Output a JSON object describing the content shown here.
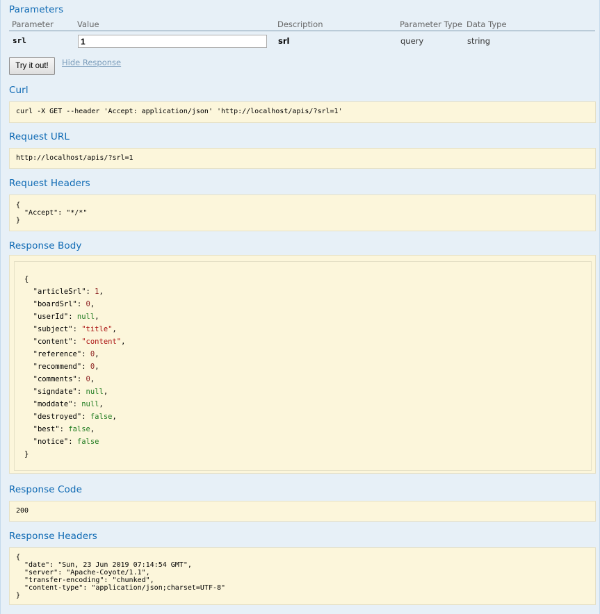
{
  "parameters": {
    "title": "Parameters",
    "headers": [
      "Parameter",
      "Value",
      "Description",
      "Parameter Type",
      "Data Type"
    ],
    "rows": [
      {
        "name": "srl",
        "value": "1",
        "description": "srl",
        "param_type": "query",
        "data_type": "string"
      }
    ]
  },
  "actions": {
    "try_label": "Try it out!",
    "hide_label": "Hide Response"
  },
  "curl": {
    "title": "Curl",
    "command": "curl -X GET --header 'Accept: application/json' 'http://localhost/apis/?srl=1'"
  },
  "request_url": {
    "title": "Request URL",
    "url": "http://localhost/apis/?srl=1"
  },
  "request_headers": {
    "title": "Request Headers",
    "lines": [
      "{",
      "  \"Accept\": \"*/*\"",
      "}"
    ]
  },
  "response_body": {
    "title": "Response Body",
    "open": "{",
    "close": "}",
    "fields": [
      {
        "key": "\"articleSrl\"",
        "value": "1",
        "type": "n",
        "comma": true
      },
      {
        "key": "\"boardSrl\"",
        "value": "0",
        "type": "n",
        "comma": true
      },
      {
        "key": "\"userId\"",
        "value": "null",
        "type": "l",
        "comma": true
      },
      {
        "key": "\"subject\"",
        "value": "\"title\"",
        "type": "s",
        "comma": true
      },
      {
        "key": "\"content\"",
        "value": "\"content\"",
        "type": "s",
        "comma": true
      },
      {
        "key": "\"reference\"",
        "value": "0",
        "type": "n",
        "comma": true
      },
      {
        "key": "\"recommend\"",
        "value": "0",
        "type": "n",
        "comma": true
      },
      {
        "key": "\"comments\"",
        "value": "0",
        "type": "n",
        "comma": true
      },
      {
        "key": "\"signdate\"",
        "value": "null",
        "type": "l",
        "comma": true
      },
      {
        "key": "\"moddate\"",
        "value": "null",
        "type": "l",
        "comma": true
      },
      {
        "key": "\"destroyed\"",
        "value": "false",
        "type": "l",
        "comma": true
      },
      {
        "key": "\"best\"",
        "value": "false",
        "type": "l",
        "comma": true
      },
      {
        "key": "\"notice\"",
        "value": "false",
        "type": "l",
        "comma": false
      }
    ]
  },
  "response_code": {
    "title": "Response Code",
    "code": "200"
  },
  "response_headers": {
    "title": "Response Headers",
    "lines": [
      "{",
      "  \"date\": \"Sun, 23 Jun 2019 07:14:54 GMT\",",
      "  \"server\": \"Apache-Coyote/1.1\",",
      "  \"transfer-encoding\": \"chunked\",",
      "  \"content-type\": \"application/json;charset=UTF-8\"",
      "}"
    ]
  },
  "colors": {
    "heading": "#0f6ab4",
    "panel_bg": "#e7f0f7",
    "code_bg": "#fcf6db",
    "number": "#8a1c1c",
    "string": "#a11",
    "literal": "#1e7a1e"
  }
}
